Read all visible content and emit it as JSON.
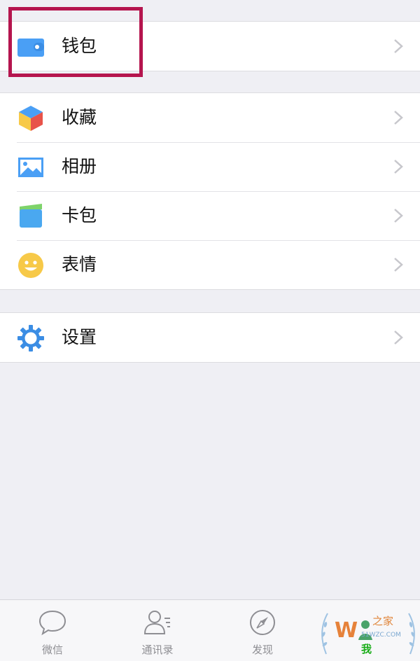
{
  "menu": {
    "wallet": {
      "label": "钱包",
      "icon": "wallet-icon"
    },
    "items": [
      {
        "label": "收藏",
        "icon": "favorites-cube-icon"
      },
      {
        "label": "相册",
        "icon": "album-image-icon"
      },
      {
        "label": "卡包",
        "icon": "card-pack-icon"
      },
      {
        "label": "表情",
        "icon": "sticker-smiley-icon"
      }
    ],
    "settings": {
      "label": "设置",
      "icon": "gear-icon"
    }
  },
  "tabbar": {
    "tabs": [
      {
        "label": "微信",
        "icon": "chat-bubble-icon"
      },
      {
        "label": "通讯录",
        "icon": "contacts-icon"
      },
      {
        "label": "发现",
        "icon": "compass-icon"
      },
      {
        "label": "我",
        "icon": "me-person-icon"
      }
    ]
  },
  "watermark": {
    "title": "之家",
    "domain": "51WZC.COM"
  },
  "colors": {
    "accent": "#1aad19",
    "highlight_box": "#b5154e",
    "icon_blue": "#4a9ff5",
    "background": "#efeff4"
  }
}
